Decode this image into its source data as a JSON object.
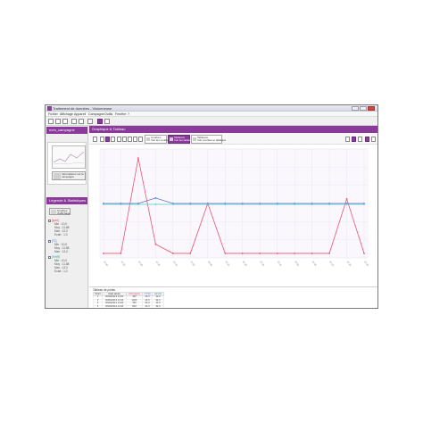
{
  "window": {
    "title": "Traitement de données - Visionneuse",
    "menu": [
      "Fichier",
      "Affichage",
      "Appareil",
      "Campagne",
      "Outils",
      "Fenêtre",
      "?"
    ]
  },
  "left": {
    "campaign_name": "nom_campagne",
    "info_button": "Informations sur la campagne",
    "legend_header": "Légende & Statistiques",
    "legend_button": "Courbes d'affichage",
    "groups": [
      {
        "label": "[ppm]",
        "rows": [
          "Min : 10,0",
          "Moy : 11,88",
          "Max : 12,0",
          "Ecart : 1,0"
        ]
      },
      {
        "label": "[°C]",
        "rows": [
          "Min : 10,0",
          "Moy : 11,88",
          "Max : 12,0"
        ]
      },
      {
        "label": "[%HR]",
        "rows": [
          "Min : 10,0",
          "Moy : 11,88",
          "Max : 12,0",
          "Ecart : 1,0"
        ]
      }
    ]
  },
  "main": {
    "header": "Graphique & Tableau",
    "modes": [
      {
        "title": "Courbes",
        "sub": "Voir les courbes"
      },
      {
        "title": "Tableaux",
        "sub": "Voir les tableaux"
      },
      {
        "title": "Tableaux",
        "sub": "Voir courbes et tableaux"
      }
    ],
    "table": {
      "title": "Tableau de points",
      "headers": [
        "Point",
        "Date Heure",
        "CO2 [ppm]",
        "T [°C]",
        "HR [%]"
      ],
      "rows": [
        [
          "1",
          "30/09/2013 14:00",
          "352",
          "23,0",
          "32,0"
        ],
        [
          "2",
          "30/09/2013 14:10",
          "1400",
          "23,0",
          "32,0"
        ],
        [
          "3",
          "30/09/2013 14:20",
          "356",
          "23,0",
          "32,0"
        ],
        [
          "4",
          "30/09/2013 14:30",
          "800",
          "23,0",
          "32,0"
        ],
        [
          "5",
          "30/09/2013 14:40",
          "352",
          "23,0",
          "32,0"
        ],
        [
          "6",
          "30/09/2013 14:50",
          "355",
          "23,0",
          "32,0"
        ],
        [
          "7",
          "30/09/2013 15:00",
          "354",
          "23,0",
          "32,0"
        ]
      ]
    }
  },
  "chart_data": {
    "type": "line",
    "x": [
      "14:00",
      "14:10",
      "14:20",
      "14:30",
      "14:40",
      "14:50",
      "15:00",
      "15:10",
      "15:20",
      "15:30",
      "15:40",
      "15:50",
      "16:00",
      "16:10",
      "16:20",
      "16:30"
    ],
    "series": [
      {
        "color": "#f0506e",
        "values": [
          250,
          250,
          1300,
          350,
          250,
          250,
          800,
          250,
          250,
          250,
          250,
          250,
          250,
          250,
          850,
          250
        ]
      },
      {
        "color": "#5b6fcf",
        "values": [
          800,
          800,
          800,
          860,
          800,
          800,
          800,
          800,
          800,
          800,
          800,
          800,
          800,
          800,
          800,
          800
        ]
      },
      {
        "color": "#4fd0c8",
        "values": [
          790,
          790,
          790,
          790,
          790,
          790,
          790,
          790,
          790,
          790,
          790,
          790,
          790,
          790,
          790,
          790
        ]
      }
    ],
    "ylim": [
      200,
      1400
    ],
    "grid": true
  },
  "colors": {
    "accent": "#8b3a9c"
  }
}
